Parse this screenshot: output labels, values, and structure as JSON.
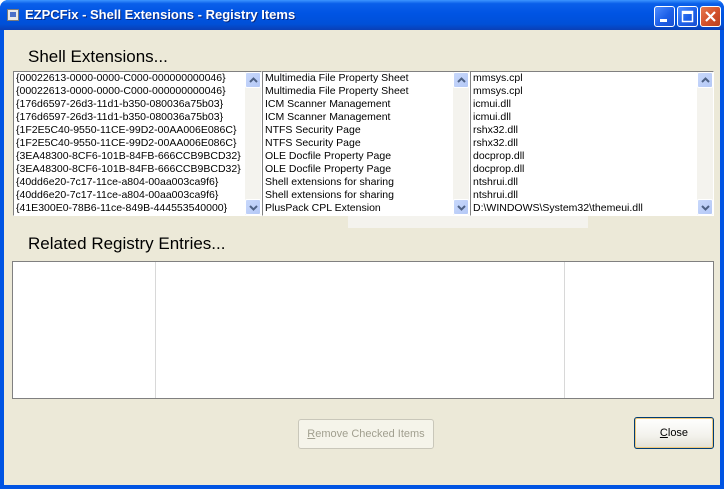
{
  "window": {
    "title": "EZPCFix - Shell Extensions - Registry Items",
    "icon": "app-icon"
  },
  "headings": {
    "shell_extensions": "Shell Extensions...",
    "related_entries": "Related Registry Entries..."
  },
  "lists": {
    "clsids": [
      "{00022613-0000-0000-C000-000000000046}",
      "{00022613-0000-0000-C000-000000000046}",
      "{176d6597-26d3-11d1-b350-080036a75b03}",
      "{176d6597-26d3-11d1-b350-080036a75b03}",
      "{1F2E5C40-9550-11CE-99D2-00AA006E086C}",
      "{1F2E5C40-9550-11CE-99D2-00AA006E086C}",
      "{3EA48300-8CF6-101B-84FB-666CCB9BCD32}",
      "{3EA48300-8CF6-101B-84FB-666CCB9BCD32}",
      "{40dd6e20-7c17-11ce-a804-00aa003ca9f6}",
      "{40dd6e20-7c17-11ce-a804-00aa003ca9f6}",
      "{41E300E0-78B6-11ce-849B-444553540000}"
    ],
    "names": [
      "Multimedia File Property Sheet",
      "Multimedia File Property Sheet",
      "ICM Scanner Management",
      "ICM Scanner Management",
      "NTFS Security Page",
      "NTFS Security Page",
      "OLE Docfile Property Page",
      "OLE Docfile Property Page",
      "Shell extensions for sharing",
      "Shell extensions for sharing",
      "PlusPack CPL Extension"
    ],
    "files": [
      "mmsys.cpl",
      "mmsys.cpl",
      "icmui.dll",
      "icmui.dll",
      "rshx32.dll",
      "rshx32.dll",
      "docprop.dll",
      "docprop.dll",
      "ntshrui.dll",
      "ntshrui.dll",
      "D:\\WINDOWS\\System32\\themeui.dll"
    ]
  },
  "buttons": {
    "remove_checked": "Remove Checked Items",
    "remove_checked_access": "R",
    "remove_checked_rest": "emove Checked Items",
    "close": "Close",
    "close_access": "C",
    "close_rest": "lose"
  },
  "colors": {
    "titlebar": "#0054e3",
    "face": "#ece9d8",
    "close_red": "#d2502a"
  }
}
